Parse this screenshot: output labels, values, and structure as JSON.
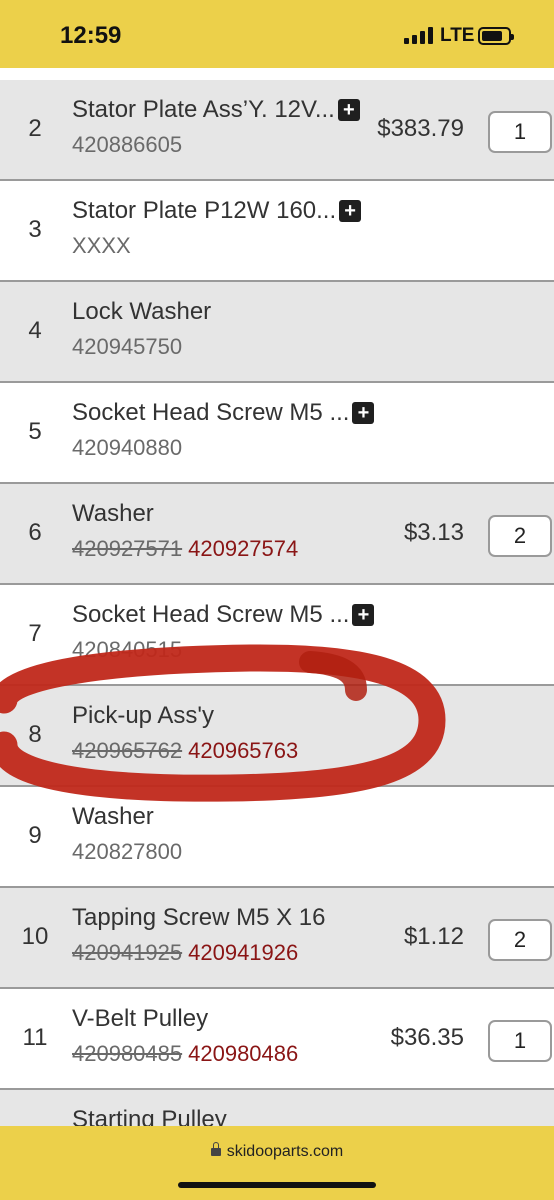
{
  "status_bar": {
    "time": "12:59",
    "network": "LTE"
  },
  "parts": [
    {
      "num": "2",
      "name": "Stator Plate Ass’Y. 12V...",
      "has_plus": true,
      "part_number": "420886605",
      "part_number_new": "",
      "price": "$383.79",
      "qty": "1",
      "shade": "gray"
    },
    {
      "num": "3",
      "name": "Stator Plate P12W 160...",
      "has_plus": true,
      "part_number": "XXXX",
      "part_number_new": "",
      "price": "",
      "qty": "",
      "shade": "white"
    },
    {
      "num": "4",
      "name": "Lock Washer",
      "has_plus": false,
      "part_number": "420945750",
      "part_number_new": "",
      "price": "",
      "qty": "",
      "shade": "gray"
    },
    {
      "num": "5",
      "name": "Socket Head Screw M5 ...",
      "has_plus": true,
      "part_number": "420940880",
      "part_number_new": "",
      "price": "",
      "qty": "",
      "shade": "white"
    },
    {
      "num": "6",
      "name": "Washer",
      "has_plus": false,
      "part_number": "420927571",
      "part_number_new": "420927574",
      "price": "$3.13",
      "qty": "2",
      "shade": "gray"
    },
    {
      "num": "7",
      "name": "Socket Head Screw M5 ...",
      "has_plus": true,
      "part_number": "420840515",
      "part_number_new": "",
      "price": "",
      "qty": "",
      "shade": "white"
    },
    {
      "num": "8",
      "name": "Pick-up Ass'y",
      "has_plus": false,
      "part_number": "420965762",
      "part_number_new": "420965763",
      "price": "",
      "qty": "",
      "shade": "gray"
    },
    {
      "num": "9",
      "name": "Washer",
      "has_plus": false,
      "part_number": "420827800",
      "part_number_new": "",
      "price": "",
      "qty": "",
      "shade": "white"
    },
    {
      "num": "10",
      "name": "Tapping Screw M5 X 16",
      "has_plus": false,
      "part_number": "420941925",
      "part_number_new": "420941926",
      "price": "$1.12",
      "qty": "2",
      "shade": "gray"
    },
    {
      "num": "11",
      "name": "V-Belt Pulley",
      "has_plus": false,
      "part_number": "420980485",
      "part_number_new": "420980486",
      "price": "$36.35",
      "qty": "1",
      "shade": "white"
    },
    {
      "num": "",
      "name": "Starting Pulley",
      "has_plus": false,
      "part_number": "",
      "part_number_new": "",
      "price": "",
      "qty": "",
      "shade": "gray"
    }
  ],
  "browser": {
    "url": "skidooparts.com"
  },
  "colors": {
    "bars": "#ecd04a",
    "annotation": "#c0281a",
    "new_part_number": "#8a1515",
    "row_gray": "#e6e6e6"
  },
  "icons": {
    "plus": "plus-box-icon",
    "lock": "lock-icon"
  }
}
